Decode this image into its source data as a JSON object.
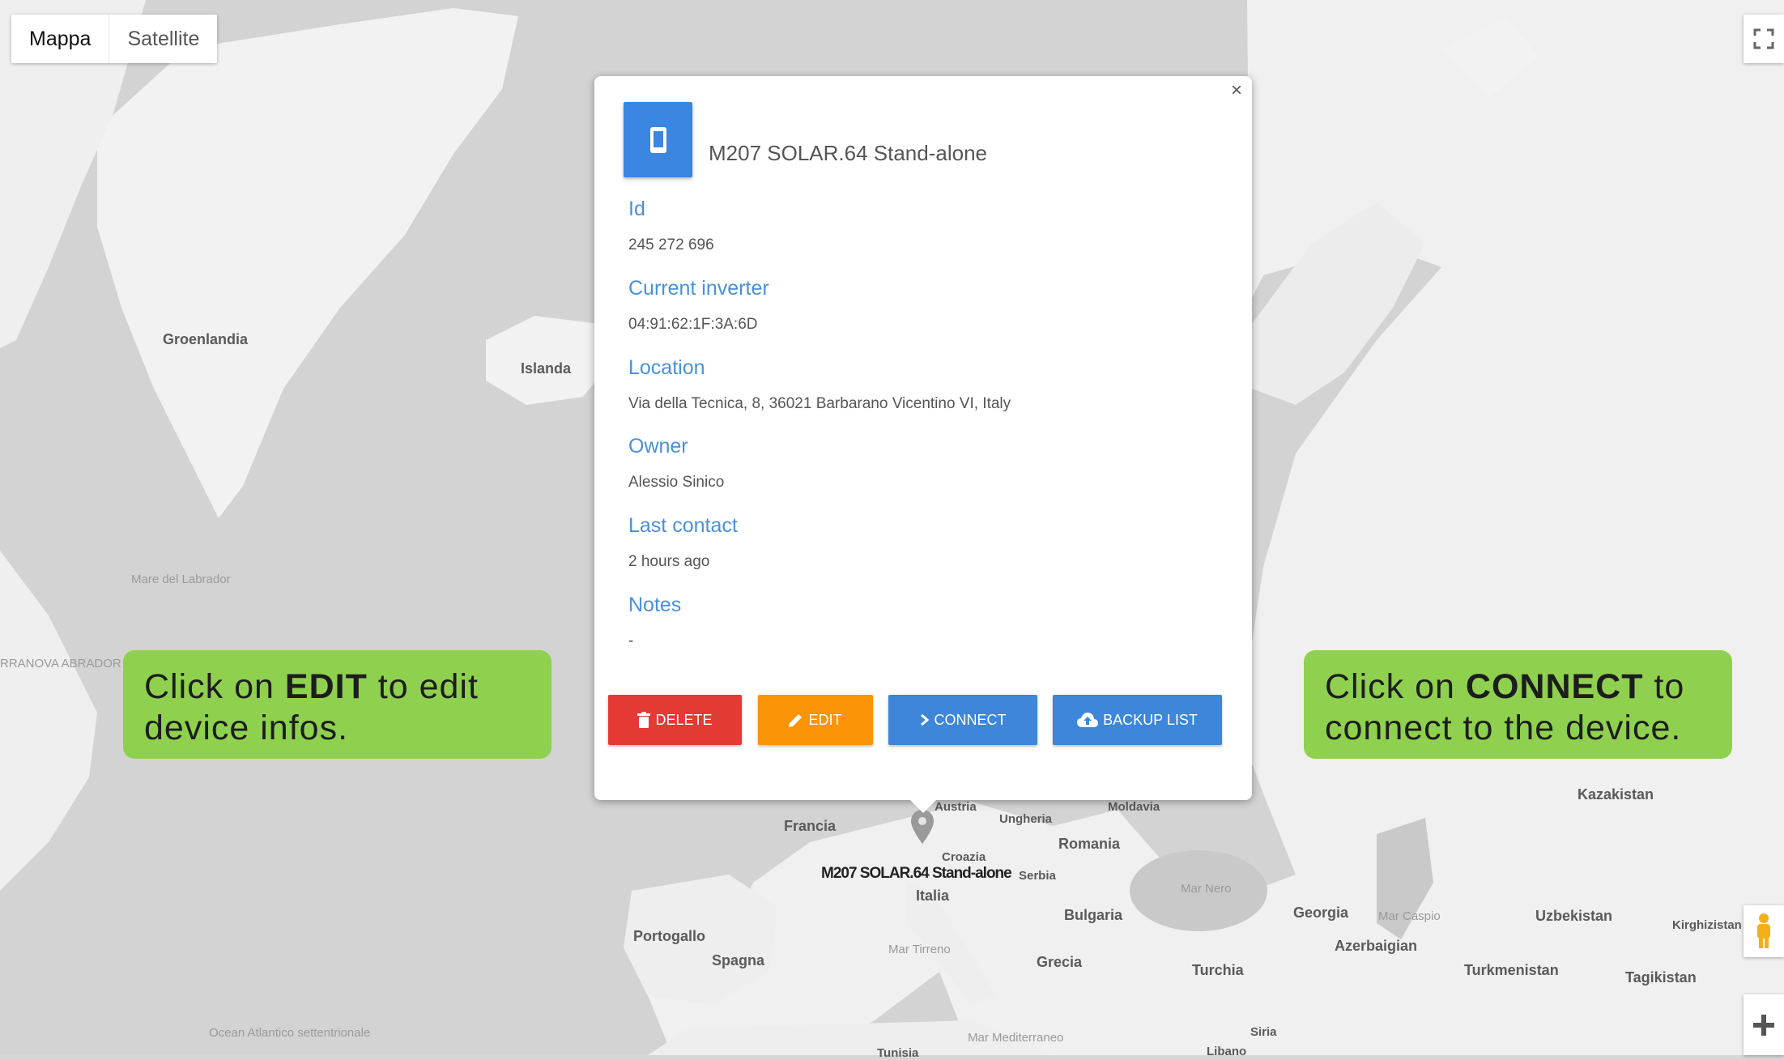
{
  "map_type": {
    "map_label": "Mappa",
    "satellite_label": "Satellite"
  },
  "places": {
    "groenlandia": "Groenlandia",
    "islanda": "Islanda",
    "mare_labrador": "Mare del Labrador",
    "terranova": "RRANOVA ABRADOR",
    "ocean_atlantico": "Ocean Atlantico settentrionale",
    "francia": "Francia",
    "austria": "Austria",
    "ungheria": "Ungheria",
    "moldavia": "Moldavia",
    "romania": "Romania",
    "croazia": "Croazia",
    "serbia": "Serbia",
    "italia": "Italia",
    "bulgaria": "Bulgaria",
    "portogallo": "Portogallo",
    "spagna": "Spagna",
    "mar_tirreno": "Mar Tirreno",
    "grecia": "Grecia",
    "turchia": "Turchia",
    "mar_nero": "Mar Nero",
    "georgia": "Georgia",
    "mar_caspio": "Mar Caspio",
    "azerbaigian": "Azerbaigian",
    "uzbekistan": "Uzbekistan",
    "turkmenistan": "Turkmenistan",
    "kirghizistan": "Kirghizistan",
    "tagikistan": "Tagikistan",
    "kazakistan": "Kazakistan",
    "tunisia": "Tunisia",
    "mar_mediterraneo": "Mar Mediterraneo",
    "siria": "Siria",
    "libano": "Libano"
  },
  "marker_label": "M207 SOLAR.64 Stand-alone",
  "device": {
    "title": "M207 SOLAR.64 Stand-alone",
    "close": "×",
    "fields": [
      {
        "label": "Id",
        "value": "245 272 696"
      },
      {
        "label": "Current inverter",
        "value": "04:91:62:1F:3A:6D"
      },
      {
        "label": "Location",
        "value": "Via della Tecnica, 8, 36021 Barbarano Vicentino VI, Italy"
      },
      {
        "label": "Owner",
        "value": "Alessio Sinico"
      },
      {
        "label": "Last contact",
        "value": "2 hours ago"
      },
      {
        "label": "Notes",
        "value": "-"
      }
    ],
    "buttons": {
      "delete": "DELETE",
      "edit": "EDIT",
      "connect": "CONNECT",
      "backup": "BACKUP LIST"
    }
  },
  "callouts": {
    "left": {
      "pre": "Click on ",
      "bold": "EDIT",
      "post": " to edit device infos."
    },
    "right": {
      "pre": "Click on ",
      "bold": "CONNECT",
      "post": " to connect to the device."
    }
  },
  "colors": {
    "delete": "#e53935",
    "edit": "#fb9406",
    "connect": "#3d86d9",
    "callout": "#8fd14f",
    "label": "#4a90d9"
  }
}
